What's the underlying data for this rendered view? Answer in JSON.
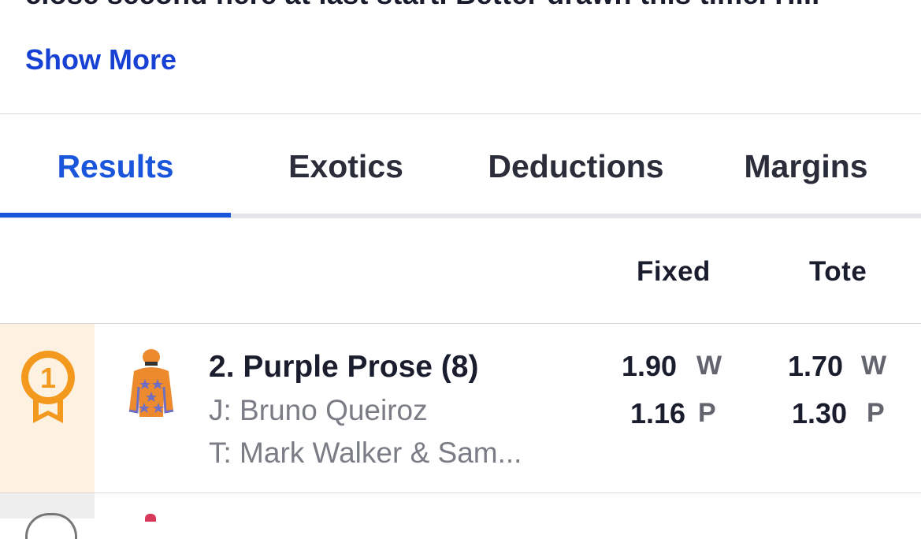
{
  "comment": {
    "truncated_text": "close second here at last start. Better drawn this time. H...",
    "show_more_label": "Show More"
  },
  "tabs": [
    {
      "label": "Results",
      "active": true
    },
    {
      "label": "Exotics",
      "active": false
    },
    {
      "label": "Deductions",
      "active": false
    },
    {
      "label": "Margins",
      "active": false
    }
  ],
  "columns": {
    "fixed": "Fixed",
    "tote": "Tote"
  },
  "results": [
    {
      "place": "1",
      "runner": "2. Purple Prose (8)",
      "jockey": "J: Bruno Queiroz",
      "trainer": "T: Mark Walker & Sam...",
      "fixed": {
        "win": "1.90",
        "place": "1.16"
      },
      "tote": {
        "win": "1.70",
        "place": "1.30"
      },
      "win_label": "W",
      "place_label": "P"
    }
  ],
  "colors": {
    "accent": "#1a56db",
    "link": "#1740d4",
    "medal_gold": "#f39a1e",
    "place_bg": "#fdf1e2",
    "silk_orange": "#ee8a2e",
    "silk_star": "#6f6fc4"
  },
  "icons": {
    "medal": "gold-medal-icon",
    "silk": "jockey-silk-icon"
  }
}
